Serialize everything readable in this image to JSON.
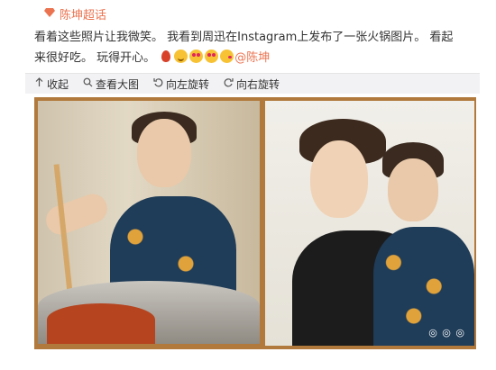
{
  "topic": {
    "label": "陈坤超话"
  },
  "post": {
    "text_before": "看着这些照片让我微笑。 我看到周迅在Instagram上发布了一张火锅图片。 看起来很好吃。 玩得开心。",
    "mention": "@陈坤"
  },
  "toolbar": {
    "collapse_label": "收起",
    "view_large_label": "查看大图",
    "rotate_left_label": "向左旋转",
    "rotate_right_label": "向右旋转"
  },
  "photo": {
    "watermark": "◎ ◎ ◎"
  },
  "colors": {
    "accent": "#eb7350",
    "frame": "#b17a3c",
    "toolbar_bg": "#f2f2f5"
  },
  "icons": {
    "topic": "topic-diamond-icon",
    "collapse": "arrow-up-icon",
    "view_large": "search-icon",
    "rotate_left": "rotate-left-icon",
    "rotate_right": "rotate-right-icon"
  }
}
